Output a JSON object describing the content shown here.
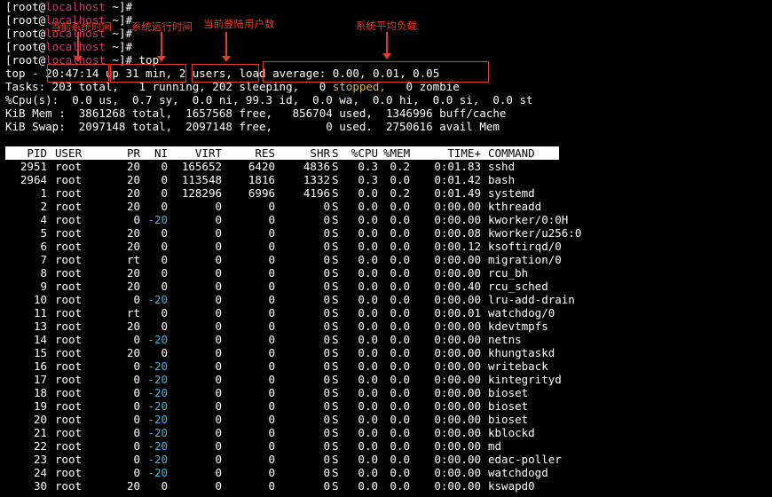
{
  "prompts": [
    {
      "user": "[root@",
      "host": "localhost",
      "rest": " ~]#"
    },
    {
      "user": "[root@",
      "host": "localhost",
      "rest": " ~]#"
    },
    {
      "user": "[root@",
      "host": "localhost",
      "rest": " ~]#"
    },
    {
      "user": "[root@",
      "host": "localhost",
      "rest": " ~]#"
    },
    {
      "user": "[root@",
      "host": "localhost",
      "rest": " ~]# top"
    }
  ],
  "summary": {
    "top_prefix": "top - ",
    "time": "20:47:14",
    "uptime": "up 31 min,",
    "users": "2 users,",
    "load": "load average: 0.00, 0.01, 0.05",
    "tasks_a": "Tasks: 203 total,   1 running, 202 sleeping,   0 ",
    "tasks_stopped": "stopped,",
    "tasks_b": "   0 zombie",
    "cpu": "%Cpu(s):  0.0 us,  0.7 sy,  0.0 ni, 99.3 id,  0.0 wa,  0.0 hi,  0.0 si,  0.0 st",
    "mem": "KiB Mem :  3861268 total,  1657568 free,   856704 used,  1346996 buff/cache",
    "swap": "KiB Swap:  2097148 total,  2097148 free,        0 used.  2750616 avail Mem"
  },
  "columns": {
    "pid": "PID",
    "user": "USER",
    "pr": "PR",
    "ni": "NI",
    "virt": "VIRT",
    "res": "RES",
    "shr": "SHR",
    "s": "S",
    "cpu": "%CPU",
    "mem": "%MEM",
    "time": "TIME+",
    "cmd": "COMMAND"
  },
  "processes": [
    {
      "pid": "2951",
      "user": "root",
      "pr": "20",
      "ni": "0",
      "virt": "165652",
      "res": "6420",
      "shr": "4836",
      "s": "S",
      "cpu": "0.3",
      "mem": "0.2",
      "time": "0:01.83",
      "cmd": "sshd"
    },
    {
      "pid": "2964",
      "user": "root",
      "pr": "20",
      "ni": "0",
      "virt": "113548",
      "res": "1816",
      "shr": "1332",
      "s": "S",
      "cpu": "0.3",
      "mem": "0.0",
      "time": "0:01.42",
      "cmd": "bash"
    },
    {
      "pid": "1",
      "user": "root",
      "pr": "20",
      "ni": "0",
      "virt": "128296",
      "res": "6996",
      "shr": "4196",
      "s": "S",
      "cpu": "0.0",
      "mem": "0.2",
      "time": "0:01.49",
      "cmd": "systemd"
    },
    {
      "pid": "2",
      "user": "root",
      "pr": "20",
      "ni": "0",
      "virt": "0",
      "res": "0",
      "shr": "0",
      "s": "S",
      "cpu": "0.0",
      "mem": "0.0",
      "time": "0:00.00",
      "cmd": "kthreadd"
    },
    {
      "pid": "4",
      "user": "root",
      "pr": "0",
      "ni": "-20",
      "virt": "0",
      "res": "0",
      "shr": "0",
      "s": "S",
      "cpu": "0.0",
      "mem": "0.0",
      "time": "0:00.00",
      "cmd": "kworker/0:0H"
    },
    {
      "pid": "5",
      "user": "root",
      "pr": "20",
      "ni": "0",
      "virt": "0",
      "res": "0",
      "shr": "0",
      "s": "S",
      "cpu": "0.0",
      "mem": "0.0",
      "time": "0:00.08",
      "cmd": "kworker/u256:0"
    },
    {
      "pid": "6",
      "user": "root",
      "pr": "20",
      "ni": "0",
      "virt": "0",
      "res": "0",
      "shr": "0",
      "s": "S",
      "cpu": "0.0",
      "mem": "0.0",
      "time": "0:00.12",
      "cmd": "ksoftirqd/0"
    },
    {
      "pid": "7",
      "user": "root",
      "pr": "rt",
      "ni": "0",
      "virt": "0",
      "res": "0",
      "shr": "0",
      "s": "S",
      "cpu": "0.0",
      "mem": "0.0",
      "time": "0:00.00",
      "cmd": "migration/0"
    },
    {
      "pid": "8",
      "user": "root",
      "pr": "20",
      "ni": "0",
      "virt": "0",
      "res": "0",
      "shr": "0",
      "s": "S",
      "cpu": "0.0",
      "mem": "0.0",
      "time": "0:00.00",
      "cmd": "rcu_bh"
    },
    {
      "pid": "9",
      "user": "root",
      "pr": "20",
      "ni": "0",
      "virt": "0",
      "res": "0",
      "shr": "0",
      "s": "S",
      "cpu": "0.0",
      "mem": "0.0",
      "time": "0:00.40",
      "cmd": "rcu_sched"
    },
    {
      "pid": "10",
      "user": "root",
      "pr": "0",
      "ni": "-20",
      "virt": "0",
      "res": "0",
      "shr": "0",
      "s": "S",
      "cpu": "0.0",
      "mem": "0.0",
      "time": "0:00.00",
      "cmd": "lru-add-drain"
    },
    {
      "pid": "11",
      "user": "root",
      "pr": "rt",
      "ni": "0",
      "virt": "0",
      "res": "0",
      "shr": "0",
      "s": "S",
      "cpu": "0.0",
      "mem": "0.0",
      "time": "0:00.01",
      "cmd": "watchdog/0"
    },
    {
      "pid": "13",
      "user": "root",
      "pr": "20",
      "ni": "0",
      "virt": "0",
      "res": "0",
      "shr": "0",
      "s": "S",
      "cpu": "0.0",
      "mem": "0.0",
      "time": "0:00.00",
      "cmd": "kdevtmpfs"
    },
    {
      "pid": "14",
      "user": "root",
      "pr": "0",
      "ni": "-20",
      "virt": "0",
      "res": "0",
      "shr": "0",
      "s": "S",
      "cpu": "0.0",
      "mem": "0.0",
      "time": "0:00.00",
      "cmd": "netns"
    },
    {
      "pid": "15",
      "user": "root",
      "pr": "20",
      "ni": "0",
      "virt": "0",
      "res": "0",
      "shr": "0",
      "s": "S",
      "cpu": "0.0",
      "mem": "0.0",
      "time": "0:00.00",
      "cmd": "khungtaskd"
    },
    {
      "pid": "16",
      "user": "root",
      "pr": "0",
      "ni": "-20",
      "virt": "0",
      "res": "0",
      "shr": "0",
      "s": "S",
      "cpu": "0.0",
      "mem": "0.0",
      "time": "0:00.00",
      "cmd": "writeback"
    },
    {
      "pid": "17",
      "user": "root",
      "pr": "0",
      "ni": "-20",
      "virt": "0",
      "res": "0",
      "shr": "0",
      "s": "S",
      "cpu": "0.0",
      "mem": "0.0",
      "time": "0:00.00",
      "cmd": "kintegrityd"
    },
    {
      "pid": "18",
      "user": "root",
      "pr": "0",
      "ni": "-20",
      "virt": "0",
      "res": "0",
      "shr": "0",
      "s": "S",
      "cpu": "0.0",
      "mem": "0.0",
      "time": "0:00.00",
      "cmd": "bioset"
    },
    {
      "pid": "19",
      "user": "root",
      "pr": "0",
      "ni": "-20",
      "virt": "0",
      "res": "0",
      "shr": "0",
      "s": "S",
      "cpu": "0.0",
      "mem": "0.0",
      "time": "0:00.00",
      "cmd": "bioset"
    },
    {
      "pid": "20",
      "user": "root",
      "pr": "0",
      "ni": "-20",
      "virt": "0",
      "res": "0",
      "shr": "0",
      "s": "S",
      "cpu": "0.0",
      "mem": "0.0",
      "time": "0:00.00",
      "cmd": "bioset"
    },
    {
      "pid": "21",
      "user": "root",
      "pr": "0",
      "ni": "-20",
      "virt": "0",
      "res": "0",
      "shr": "0",
      "s": "S",
      "cpu": "0.0",
      "mem": "0.0",
      "time": "0:00.00",
      "cmd": "kblockd"
    },
    {
      "pid": "22",
      "user": "root",
      "pr": "0",
      "ni": "-20",
      "virt": "0",
      "res": "0",
      "shr": "0",
      "s": "S",
      "cpu": "0.0",
      "mem": "0.0",
      "time": "0:00.00",
      "cmd": "md"
    },
    {
      "pid": "23",
      "user": "root",
      "pr": "0",
      "ni": "-20",
      "virt": "0",
      "res": "0",
      "shr": "0",
      "s": "S",
      "cpu": "0.0",
      "mem": "0.0",
      "time": "0:00.00",
      "cmd": "edac-poller"
    },
    {
      "pid": "24",
      "user": "root",
      "pr": "0",
      "ni": "-20",
      "virt": "0",
      "res": "0",
      "shr": "0",
      "s": "S",
      "cpu": "0.0",
      "mem": "0.0",
      "time": "0:00.00",
      "cmd": "watchdogd"
    },
    {
      "pid": "30",
      "user": "root",
      "pr": "20",
      "ni": "0",
      "virt": "0",
      "res": "0",
      "shr": "0",
      "s": "S",
      "cpu": "0.0",
      "mem": "0.0",
      "time": "0:00.00",
      "cmd": "kswapd0"
    }
  ],
  "annotations": {
    "current_time": "当前系统时间",
    "uptime": "系统运行时间",
    "users": "当前登陆用户数",
    "load": "系统平均负载"
  },
  "colors": {
    "background": "#000000",
    "text": "#ffffff",
    "hostname": "#c43a72",
    "stopped": "#d8b53a",
    "negative_nice": "#3fb4dc",
    "annotation": "#e23b2a"
  }
}
